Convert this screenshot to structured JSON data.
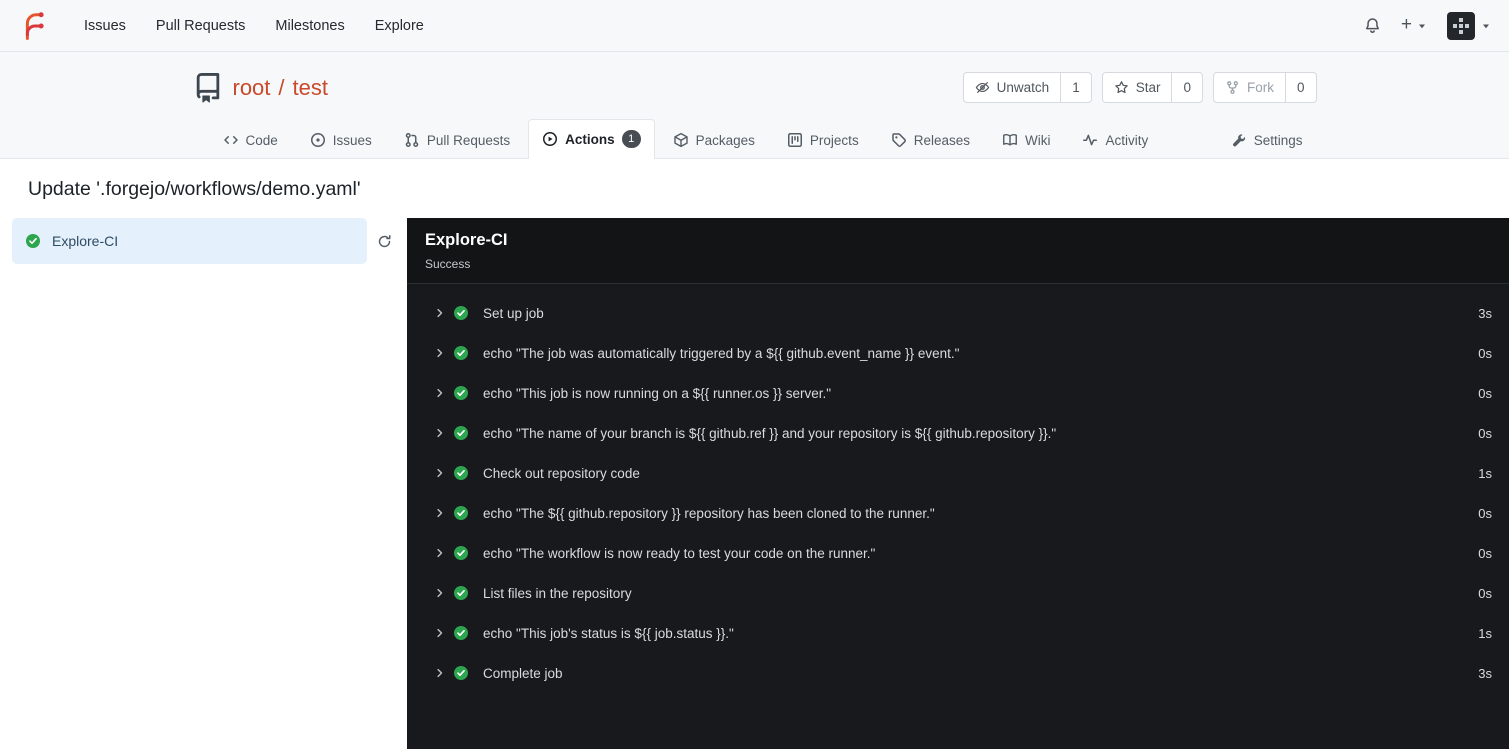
{
  "colors": {
    "brand_orange": "#e4572e",
    "brand_red": "#d9383f",
    "repo_link": "#c9492a",
    "success_green": "#2da44e",
    "panel_background": "#17191c",
    "selected_job_background": "#e4f0fb"
  },
  "navbar": {
    "items": [
      {
        "label": "Issues"
      },
      {
        "label": "Pull Requests"
      },
      {
        "label": "Milestones"
      },
      {
        "label": "Explore"
      }
    ]
  },
  "repo": {
    "owner": "root",
    "separator": "/",
    "name": "test",
    "watch": {
      "label": "Unwatch",
      "count": "1"
    },
    "star": {
      "label": "Star",
      "count": "0"
    },
    "fork": {
      "label": "Fork",
      "count": "0"
    }
  },
  "tabs": [
    {
      "label": "Code"
    },
    {
      "label": "Issues"
    },
    {
      "label": "Pull Requests"
    },
    {
      "label": "Actions",
      "badge": "1"
    },
    {
      "label": "Packages"
    },
    {
      "label": "Projects"
    },
    {
      "label": "Releases"
    },
    {
      "label": "Wiki"
    },
    {
      "label": "Activity"
    },
    {
      "label": "Settings"
    }
  ],
  "run": {
    "title": "Update '.forgejo/workflows/demo.yaml'",
    "job_name": "Explore-CI",
    "status": "Success",
    "steps": [
      {
        "name": "Set up job",
        "duration": "3s"
      },
      {
        "name": "echo \"The job was automatically triggered by a ${{ github.event_name }} event.\"",
        "duration": "0s"
      },
      {
        "name": "echo \"This job is now running on a ${{ runner.os }} server.\"",
        "duration": "0s"
      },
      {
        "name": "echo \"The name of your branch is ${{ github.ref }} and your repository is ${{ github.repository }}.\"",
        "duration": "0s"
      },
      {
        "name": "Check out repository code",
        "duration": "1s"
      },
      {
        "name": "echo \"The ${{ github.repository }} repository has been cloned to the runner.\"",
        "duration": "0s"
      },
      {
        "name": "echo \"The workflow is now ready to test your code on the runner.\"",
        "duration": "0s"
      },
      {
        "name": "List files in the repository",
        "duration": "0s"
      },
      {
        "name": "echo \"This job's status is ${{ job.status }}.\"",
        "duration": "1s"
      },
      {
        "name": "Complete job",
        "duration": "3s"
      }
    ]
  }
}
